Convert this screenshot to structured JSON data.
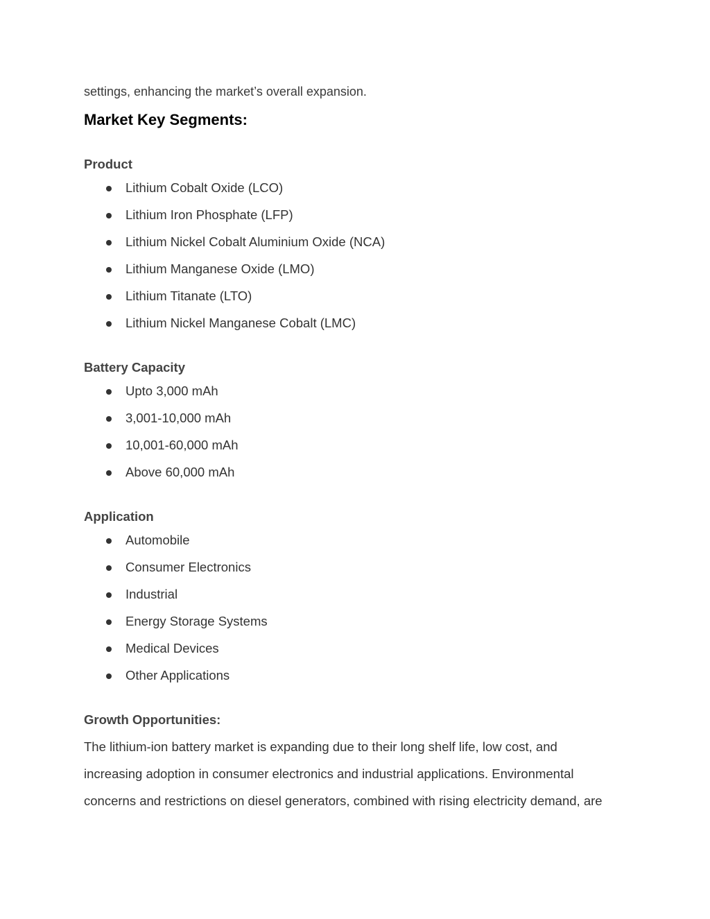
{
  "intro_text": "settings, enhancing the market’s overall expansion.",
  "section_title": "Market Key Segments:",
  "segments": [
    {
      "heading": "Product",
      "items": [
        "Lithium Cobalt Oxide (LCO)",
        "Lithium Iron Phosphate (LFP)",
        "Lithium Nickel Cobalt Aluminium Oxide (NCA)",
        "Lithium Manganese Oxide (LMO)",
        "Lithium Titanate (LTO)",
        "Lithium Nickel Manganese Cobalt (LMC)"
      ]
    },
    {
      "heading": "Battery Capacity",
      "items": [
        "Upto 3,000 mAh",
        "3,001-10,000 mAh",
        "10,001-60,000 mAh",
        "Above 60,000 mAh"
      ]
    },
    {
      "heading": "Application",
      "items": [
        "Automobile",
        "Consumer Electronics",
        "Industrial",
        "Energy Storage Systems",
        "Medical Devices",
        "Other Applications"
      ]
    }
  ],
  "growth": {
    "heading": "Growth Opportunities:",
    "lines": [
      "The lithium-ion battery market is expanding due to their long shelf life, low cost, and",
      "increasing adoption in consumer electronics and industrial applications. Environmental",
      "concerns and restrictions on diesel generators, combined with rising electricity demand, are"
    ]
  }
}
